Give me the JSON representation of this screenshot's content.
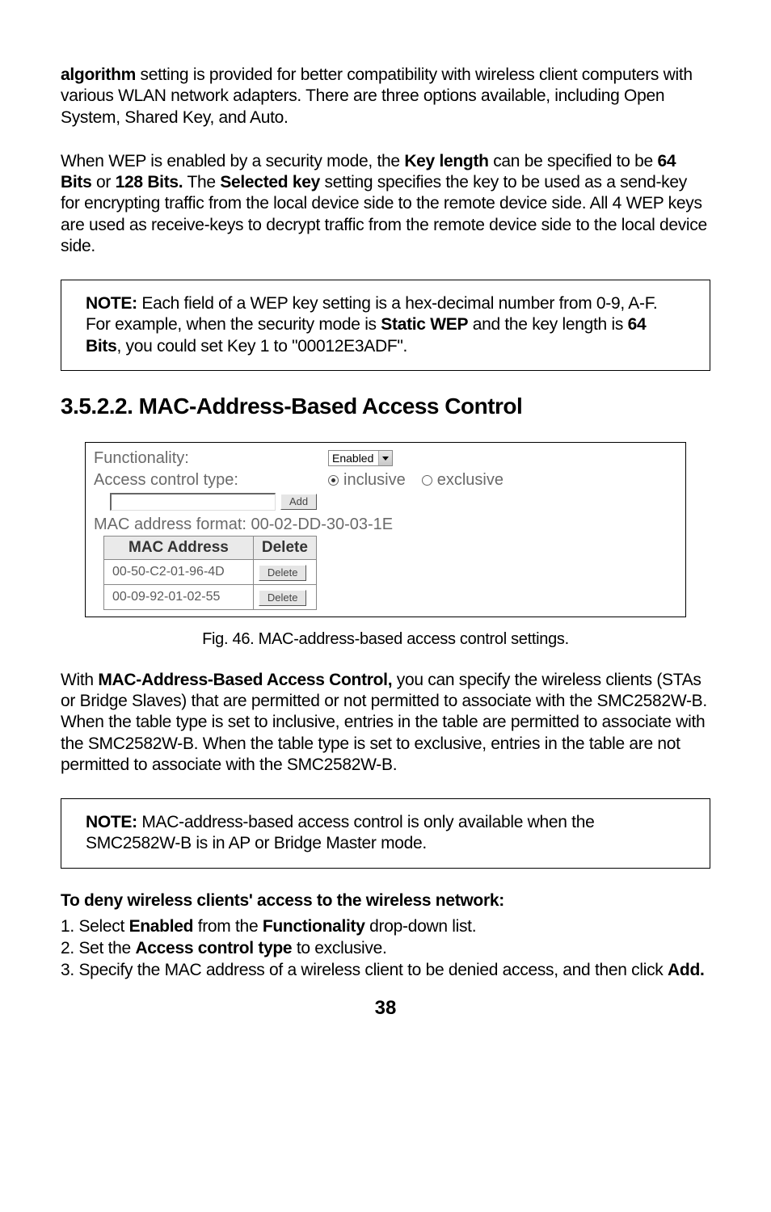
{
  "para1a": "algorithm",
  "para1b": " setting is provided for better compatibility with wireless client computers with various WLAN network adapters. There are three options available, including Open System, Shared Key, and Auto.",
  "para2a": "When WEP is enabled by a security mode, the ",
  "para2b": "Key length",
  "para2c": " can be specified to be ",
  "para2d": "64 Bits",
  "para2e": " or ",
  "para2f": "128 Bits.",
  "para2g": " The ",
  "para2h": "Selected key",
  "para2i": " setting specifies the key to be used as a send-key for encrypting traffic from the local device side to the remote device side. All 4 WEP keys are used as receive-keys to decrypt traffic from the remote device side to the local device side.",
  "note1a": "NOTE:",
  "note1b": " Each field of a WEP key setting is a hex-decimal number from 0-9, A-F. For example, when the security mode is ",
  "note1c": "Static WEP",
  "note1d": " and the key length is ",
  "note1e": "64 Bits",
  "note1f": ", you could set Key 1 to \"00012E3ADF\".",
  "heading": "3.5.2.2. MAC-Address-Based Access Control",
  "ss": {
    "functionality_label": "Functionality:",
    "functionality_value": "Enabled",
    "access_type_label": "Access control type:",
    "radio_inclusive": "inclusive",
    "radio_exclusive": "exclusive",
    "add_btn": "Add",
    "format_text": "MAC address format: 00-02-DD-30-03-1E",
    "table_header_mac": "MAC Address",
    "table_header_delete": "Delete",
    "rows": [
      {
        "mac": "00-50-C2-01-96-4D",
        "btn": "Delete"
      },
      {
        "mac": "00-09-92-01-02-55",
        "btn": "Delete"
      }
    ]
  },
  "caption": "Fig. 46. MAC-address-based access control settings.",
  "para3a": "With ",
  "para3b": "MAC-Address-Based Access Control,",
  "para3c": " you can specify the wireless clients (STAs or Bridge Slaves) that are permitted or not permitted to associate with the SMC2582W-B. When the table type is set to inclusive, entries in the table are permitted to associate with the SMC2582W-B. When the table type is set to exclusive, entries in the table are not permitted to associate with the SMC2582W-B.",
  "note2a": "NOTE:",
  "note2b": " MAC-address-based access control is only available when the SMC2582W-B is in AP or Bridge Master mode.",
  "sub_heading": "To deny wireless clients' access to the wireless network:",
  "steps": {
    "s1a": "1.  Select ",
    "s1b": "Enabled",
    "s1c": "  from the ",
    "s1d": "Functionality",
    "s1e": " drop-down list.",
    "s2a": "2.  Set the ",
    "s2b": "Access control type",
    "s2c": " to exclusive.",
    "s3a": "3.  Specify the MAC address of a wireless client to be denied access, and then click ",
    "s3b": "Add."
  },
  "page_num": "38"
}
